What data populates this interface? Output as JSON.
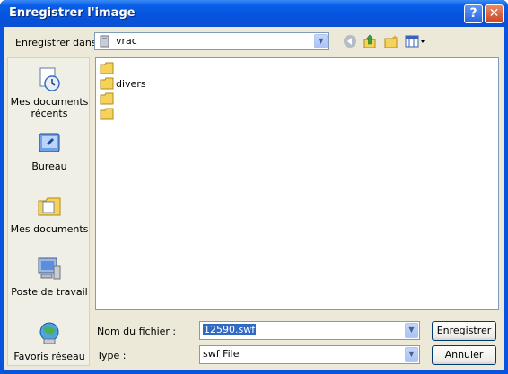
{
  "window": {
    "title": "Enregistrer l'image",
    "help_glyph": "?",
    "close_glyph": "✕"
  },
  "toolbar": {
    "save_in_label": "Enregistrer dans :",
    "save_in_value": "vrac",
    "back_icon": "back-icon",
    "up_icon": "up-folder-icon",
    "new_folder_icon": "new-folder-icon",
    "view_icon": "view-menu-icon"
  },
  "places": [
    {
      "label_line1": "Mes documents",
      "label_line2": "récents"
    },
    {
      "label_line1": "Bureau",
      "label_line2": ""
    },
    {
      "label_line1": "Mes documents",
      "label_line2": ""
    },
    {
      "label_line1": "Poste de travail",
      "label_line2": ""
    },
    {
      "label_line1": "Favoris réseau",
      "label_line2": ""
    }
  ],
  "files": [
    {
      "name": ""
    },
    {
      "name": "divers"
    },
    {
      "name": ""
    },
    {
      "name": ""
    }
  ],
  "form": {
    "filename_label": "Nom du fichier :",
    "filename_value": "12590.swf",
    "type_label": "Type :",
    "type_value": "swf File",
    "save_button": "Enregistrer",
    "cancel_button": "Annuler"
  },
  "colors": {
    "title_blue": "#0554df",
    "face": "#ece9d8",
    "selection": "#316ac5"
  }
}
